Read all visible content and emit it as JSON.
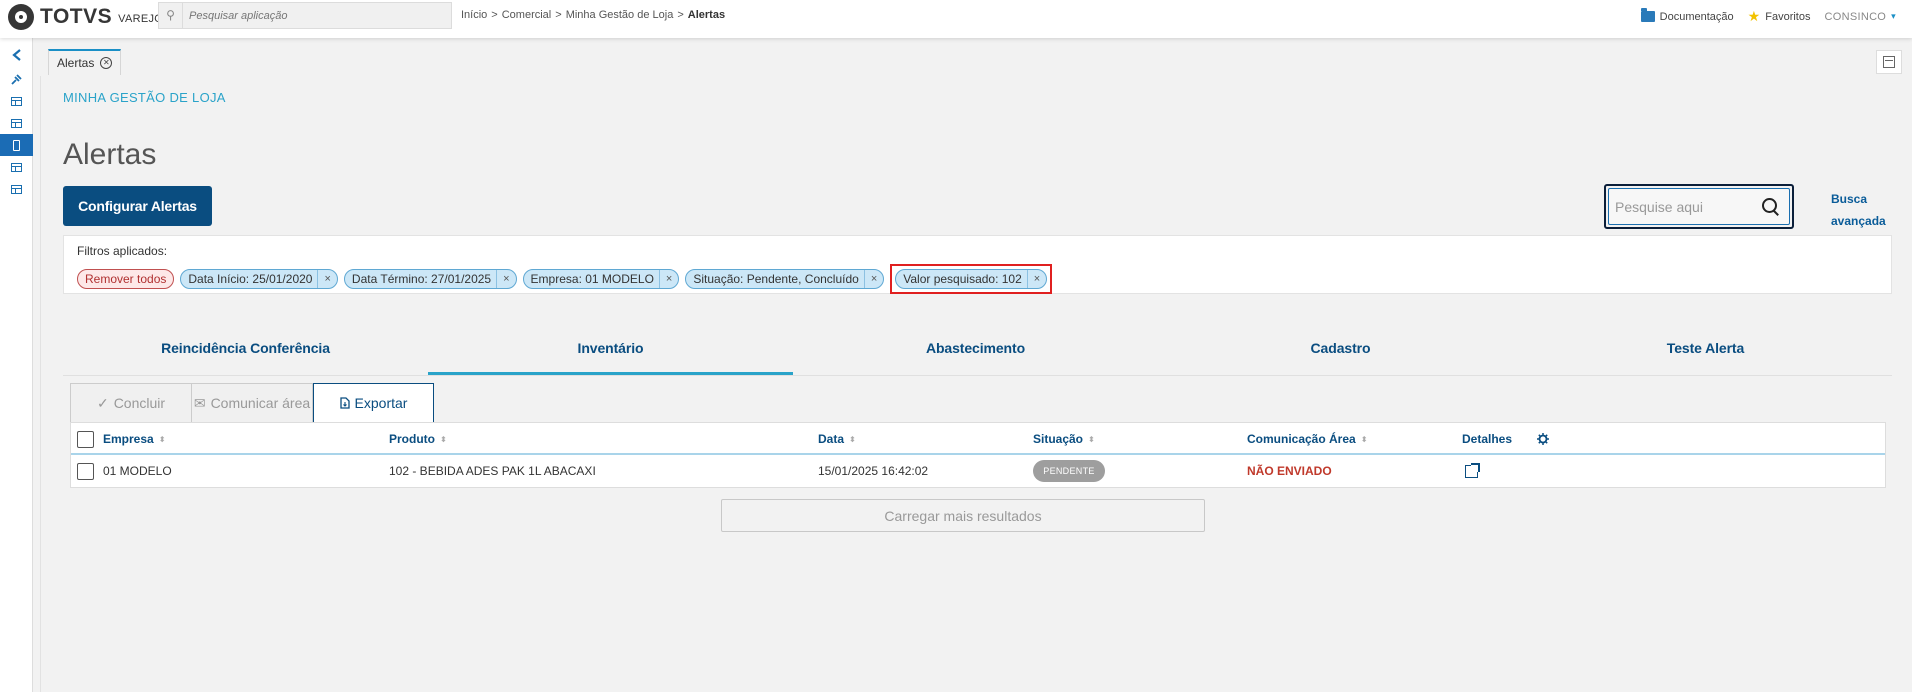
{
  "brand": {
    "name": "TOTVS",
    "sub": "VAREJO"
  },
  "app_search": {
    "placeholder": "Pesquisar aplicação"
  },
  "breadcrumb": {
    "items": [
      "Início",
      ">",
      "Comercial",
      ">",
      "Minha Gestão de Loja",
      ">"
    ],
    "current": "Alertas"
  },
  "top_right": {
    "docs": "Documentação",
    "favorites": "Favoritos",
    "user": "CONSINCO"
  },
  "open_tab": {
    "label": "Alertas"
  },
  "page": {
    "subtitle": "MINHA GESTÃO DE LOJA",
    "title": "Alertas",
    "config_button": "Configurar Alertas"
  },
  "search": {
    "placeholder": "Pesquise aqui",
    "advanced_line1": "Busca",
    "advanced_line2": "avançada"
  },
  "filters": {
    "label": "Filtros aplicados:",
    "remove_all": "Remover todos",
    "chips": [
      "Data Início: 25/01/2020",
      "Data Término: 27/01/2025",
      "Empresa: 01 MODELO",
      "Situação: Pendente, Concluído",
      "Valor pesquisado: 102"
    ],
    "remove_glyph": "×"
  },
  "tabs": [
    "Reincidência Conferência",
    "Inventário",
    "Abastecimento",
    "Cadastro",
    "Teste Alerta"
  ],
  "active_tab": "Inventário",
  "actions": {
    "conclude": "Concluir",
    "communicate": "Comunicar área",
    "export": "Exportar"
  },
  "table": {
    "headers": {
      "empresa": "Empresa",
      "produto": "Produto",
      "data": "Data",
      "situacao": "Situação",
      "comunicacao": "Comunicação Área",
      "detalhes": "Detalhes"
    },
    "rows": [
      {
        "empresa": "01 MODELO",
        "produto": "102 - BEBIDA ADES PAK 1L ABACAXI",
        "data": "15/01/2025 16:42:02",
        "situacao": "PENDENTE",
        "comunicacao": "NÃO ENVIADO"
      }
    ]
  },
  "load_more": "Carregar mais resultados",
  "colors": {
    "primary": "#0a4d80",
    "accent": "#2aa3c9",
    "highlight": "#e02020",
    "status_red": "#c0392b"
  }
}
